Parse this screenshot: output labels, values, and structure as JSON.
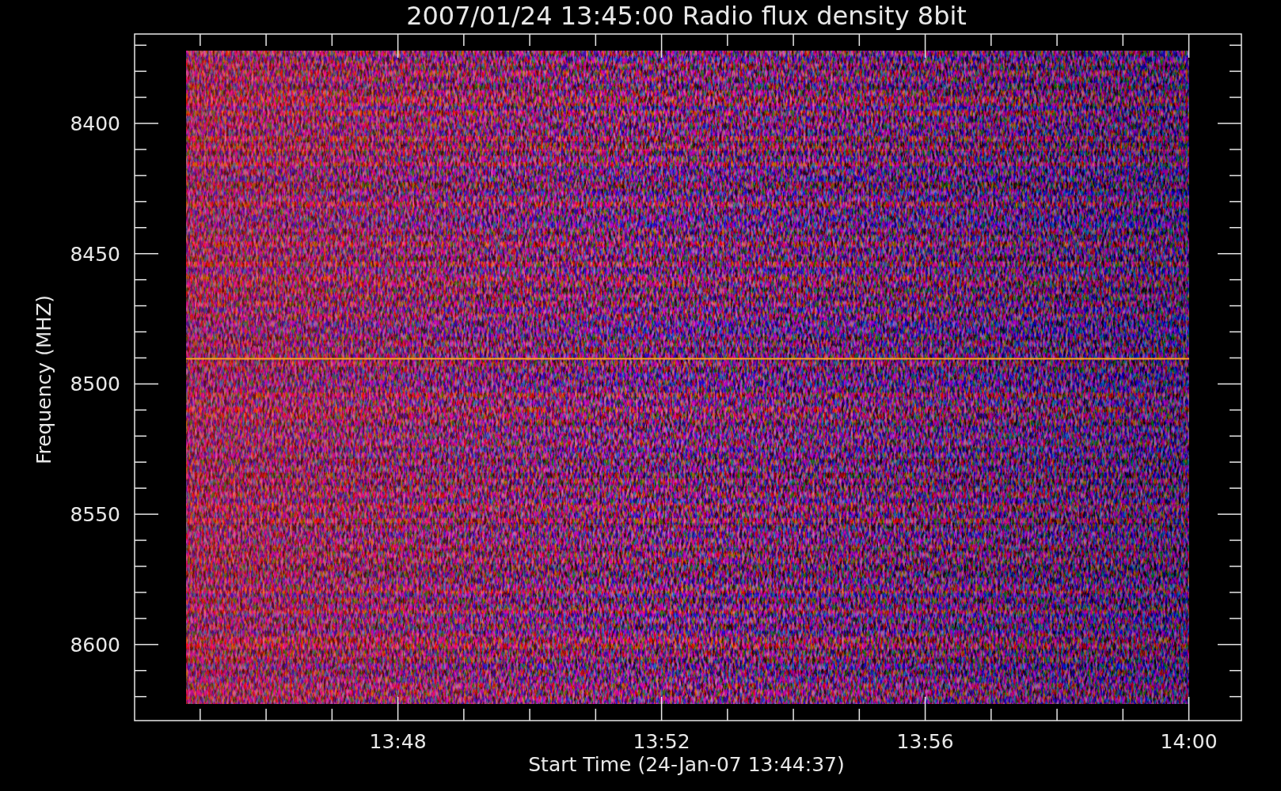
{
  "plot": {
    "title": "2007/01/24 13:45:00 Radio flux density 8bit",
    "y_label": "Frequency (MHZ)",
    "x_label": "Start Time (24-Jan-07 13:44:37)",
    "y_tick_labels": [
      "8400",
      "8450",
      "8500",
      "8550",
      "8600"
    ],
    "x_tick_labels": [
      "13:48",
      "13:52",
      "13:56",
      "14:00"
    ]
  }
}
